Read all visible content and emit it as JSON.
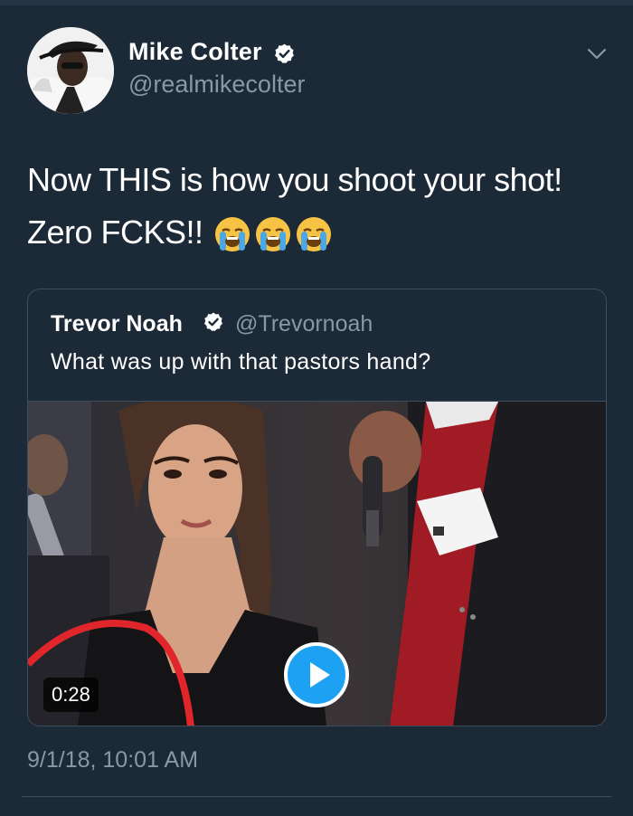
{
  "tweet": {
    "author_name": "Mike Colter",
    "author_handle": "@realmikecolter",
    "text_line1": "Now THIS is how you shoot your shot!",
    "text_line2": "Zero FCKS!!",
    "emojis": [
      "loudly-crying-face",
      "loudly-crying-face",
      "loudly-crying-face"
    ],
    "timestamp": "9/1/18, 10:01 AM"
  },
  "quoted_tweet": {
    "author_name": "Trevor Noah",
    "author_handle": "@Trevornoah",
    "text": "What was up with that pastors hand?",
    "video_duration": "0:28"
  },
  "colors": {
    "background": "#1c2937",
    "secondary_text": "#8899a6",
    "border": "#3d4e5f",
    "accent_blue": "#1da1f2",
    "highlight_circle": "#e0262a"
  },
  "icons": {
    "verified": "verified-badge-icon",
    "menu": "chevron-down-icon",
    "play": "play-icon"
  }
}
